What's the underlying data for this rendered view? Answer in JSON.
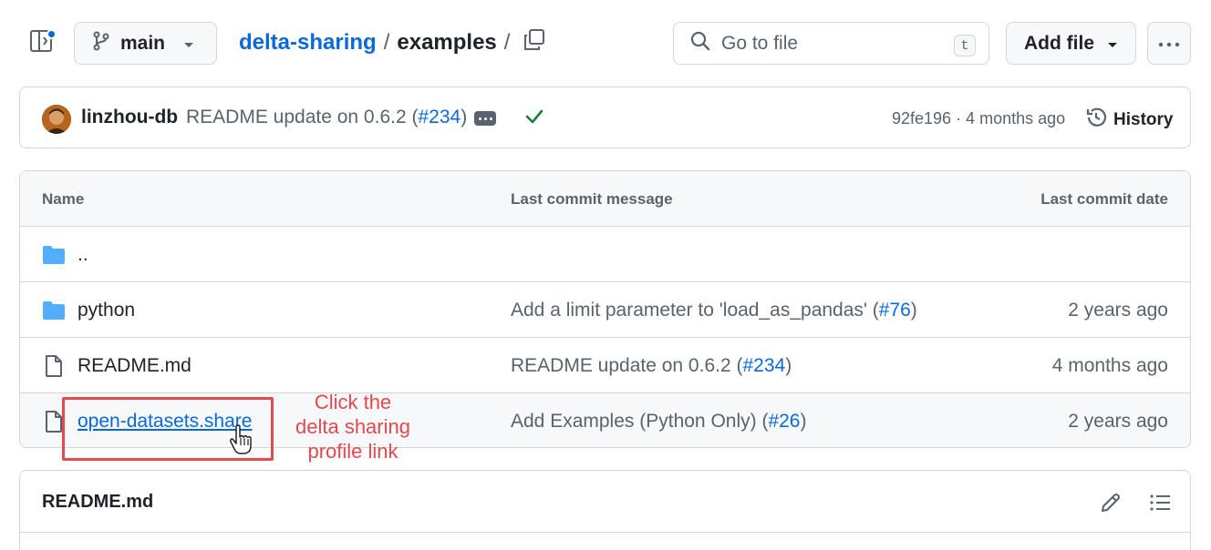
{
  "topbar": {
    "branch": "main",
    "breadcrumb": {
      "repo": "delta-sharing",
      "sep1": "/",
      "folder": "examples",
      "sep2": "/"
    },
    "search_placeholder": "Go to file",
    "search_shortcut": "t",
    "add_file_label": "Add file"
  },
  "commit": {
    "author": "linzhou-db",
    "message_prefix": "README update on 0.6.2 (",
    "message_link": "#234",
    "message_suffix": ")",
    "status": "success",
    "meta": "92fe196 · 4 months ago",
    "history_label": "History"
  },
  "table": {
    "headers": {
      "name": "Name",
      "message": "Last commit message",
      "date": "Last commit date"
    },
    "rows": [
      {
        "type": "folder",
        "name": "..",
        "msg_prefix": "",
        "msg_link": "",
        "msg_suffix": "",
        "date": ""
      },
      {
        "type": "folder",
        "name": "python",
        "msg_prefix": "Add a limit parameter to 'load_as_pandas' (",
        "msg_link": "#76",
        "msg_suffix": ")",
        "date": "2 years ago"
      },
      {
        "type": "file",
        "name": "README.md",
        "msg_prefix": "README update on 0.6.2 (",
        "msg_link": "#234",
        "msg_suffix": ")",
        "date": "4 months ago"
      },
      {
        "type": "file",
        "name": "open-datasets.share",
        "msg_prefix": "Add Examples (Python Only) (",
        "msg_link": "#26",
        "msg_suffix": ")",
        "date": "2 years ago"
      }
    ]
  },
  "annotation": {
    "line1": "Click the",
    "line2": "delta sharing",
    "line3": "profile link",
    "color": "#e5484d"
  },
  "readme": {
    "title": "README.md"
  },
  "colors": {
    "accent": "#0969da",
    "folder": "#54aeff",
    "success": "#1a7f37",
    "muted": "#59636e"
  }
}
